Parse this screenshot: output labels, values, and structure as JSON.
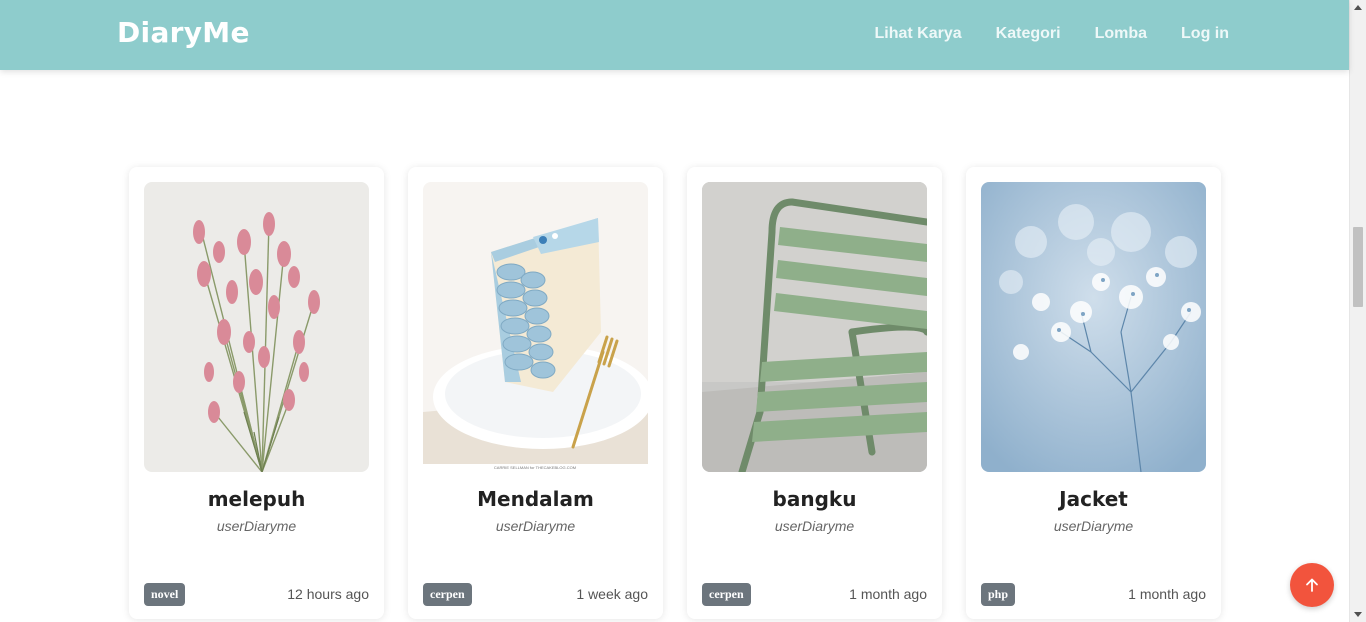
{
  "navbar": {
    "brand": "DiaryMe",
    "links": [
      "Lihat Karya",
      "Kategori",
      "Lomba",
      "Log in"
    ]
  },
  "cards": [
    {
      "title": "melepuh",
      "author": "userDiaryme",
      "tag": "novel",
      "time": "12 hours ago",
      "image": "pink-dried-flowers-image"
    },
    {
      "title": "Mendalam",
      "author": "userDiaryme",
      "tag": "cerpen",
      "time": "1 week ago",
      "image": "blue-cake-slice-image"
    },
    {
      "title": "bangku",
      "author": "userDiaryme",
      "tag": "cerpen",
      "time": "1 month ago",
      "image": "green-chair-image"
    },
    {
      "title": "Jacket",
      "author": "userDiaryme",
      "tag": "php",
      "time": "1 month ago",
      "image": "blue-baby-breath-flowers-image"
    }
  ],
  "cake_caption": "CARRIE SELLMAN for THECAKEBLOG.COM",
  "colors": {
    "navbar": "#8ecccc",
    "badge": "#6c757d",
    "top_button": "#f2543d"
  },
  "icons": {
    "top_button": "arrow-up-icon"
  }
}
